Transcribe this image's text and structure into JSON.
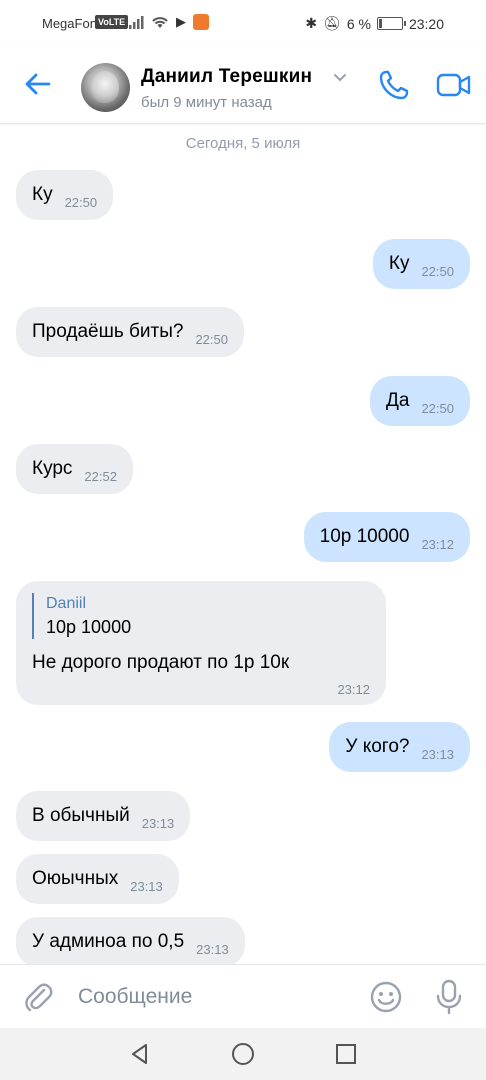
{
  "status_bar": {
    "carrier": "MegaFon",
    "volte": "VoLTE",
    "battery": "6 %",
    "time": "23:20"
  },
  "header": {
    "contact_name": "Даниил Терешкин",
    "last_seen": "был 9 минут назад",
    "icons": [
      "back-arrow-icon",
      "chevron-down-icon",
      "phone-icon",
      "video-camera-icon"
    ]
  },
  "chat": {
    "date_separator": "Сегодня, 5 июля",
    "messages": [
      {
        "dir": "in",
        "text": "Ку",
        "time": "22:50"
      },
      {
        "dir": "out",
        "text": "Ку",
        "time": "22:50"
      },
      {
        "dir": "in",
        "text": "Продаёшь биты?",
        "time": "22:50"
      },
      {
        "dir": "out",
        "text": "Да",
        "time": "22:50"
      },
      {
        "dir": "in",
        "text": "Курс",
        "time": "22:52"
      },
      {
        "dir": "out",
        "text": "10р 10000",
        "time": "23:12"
      },
      {
        "dir": "in",
        "reply_author": "Daniil",
        "reply_text": "10р 10000",
        "text": "Не дорого продают по 1р 10к",
        "time": "23:12"
      },
      {
        "dir": "out",
        "text": "У кого?",
        "time": "23:13"
      },
      {
        "dir": "in",
        "text": "В обычный",
        "time": "23:13"
      },
      {
        "dir": "in",
        "text": "Оюычных",
        "time": "23:13"
      },
      {
        "dir": "in",
        "text": "У админоа по 0,5",
        "time": "23:13"
      }
    ]
  },
  "composer": {
    "placeholder": "Сообщение",
    "icons": [
      "paperclip-icon",
      "emoji-icon",
      "microphone-icon"
    ]
  },
  "colors": {
    "accent": "#2787f5",
    "incoming_bubble": "#ebedf0",
    "outgoing_bubble": "#cce4ff",
    "secondary_text": "#818c99"
  }
}
